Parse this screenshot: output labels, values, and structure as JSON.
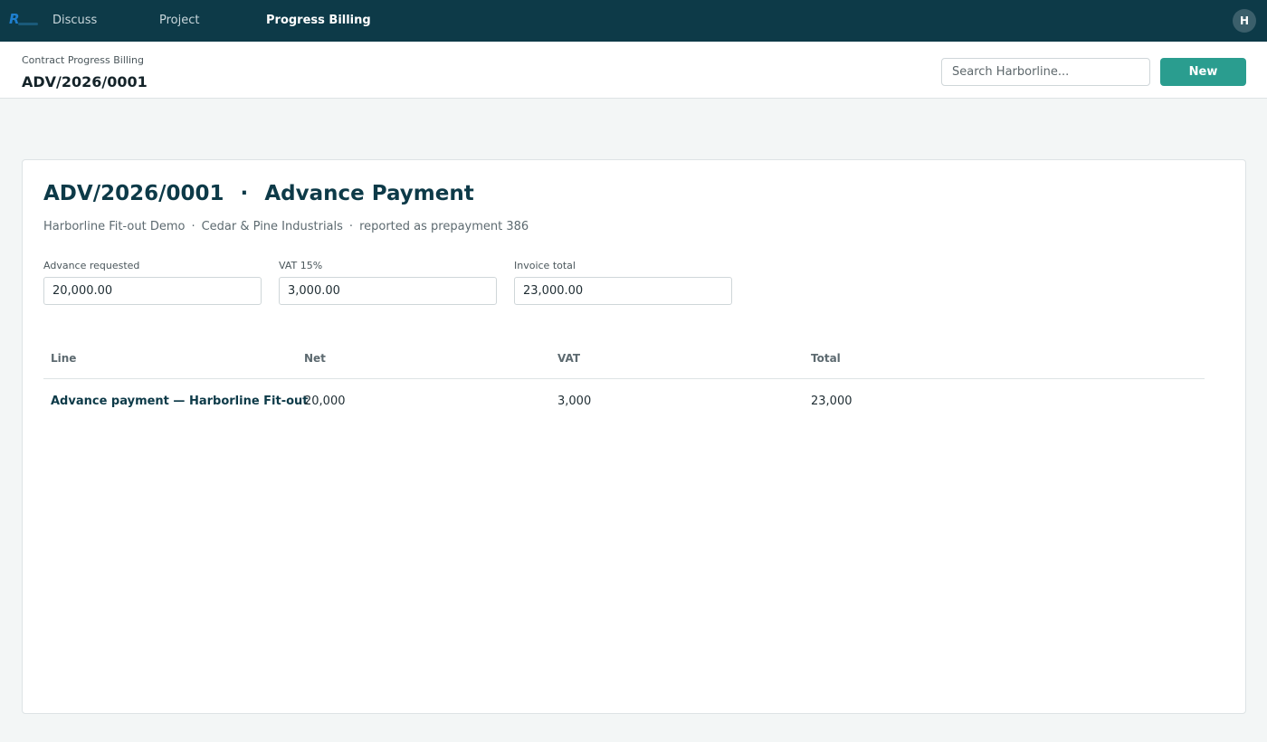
{
  "navbar": {
    "items": [
      {
        "label": "Discuss"
      },
      {
        "label": "Project"
      },
      {
        "label": "Progress Billing"
      }
    ],
    "avatar_initial": "H"
  },
  "control": {
    "breadcrumb": "Contract Progress Billing",
    "record_title": "ADV/2026/0001",
    "search_placeholder": "Search Harborline...",
    "new_label": "New"
  },
  "sheet": {
    "heading_ref": "ADV/2026/0001",
    "heading_sep": "·",
    "heading_kind": "Advance Payment",
    "meta": {
      "project": "Harborline Fit-out Demo",
      "partner": "Cedar & Pine Industrials",
      "note": "reported as prepayment 386",
      "separator": "·"
    },
    "fields": [
      {
        "label": "Advance requested",
        "value": "20,000.00"
      },
      {
        "label": "VAT 15%",
        "value": "3,000.00"
      },
      {
        "label": "Invoice total",
        "value": "23,000.00"
      }
    ],
    "table": {
      "headers": [
        "Line",
        "Net",
        "VAT",
        "Total"
      ],
      "rows": [
        {
          "line": "Advance payment — Harborline Fit-out",
          "net": "20,000",
          "vat": "3,000",
          "total": "23,000"
        }
      ]
    }
  },
  "colors": {
    "navbar": "#0d3a48",
    "accent": "#2a9d8f"
  }
}
